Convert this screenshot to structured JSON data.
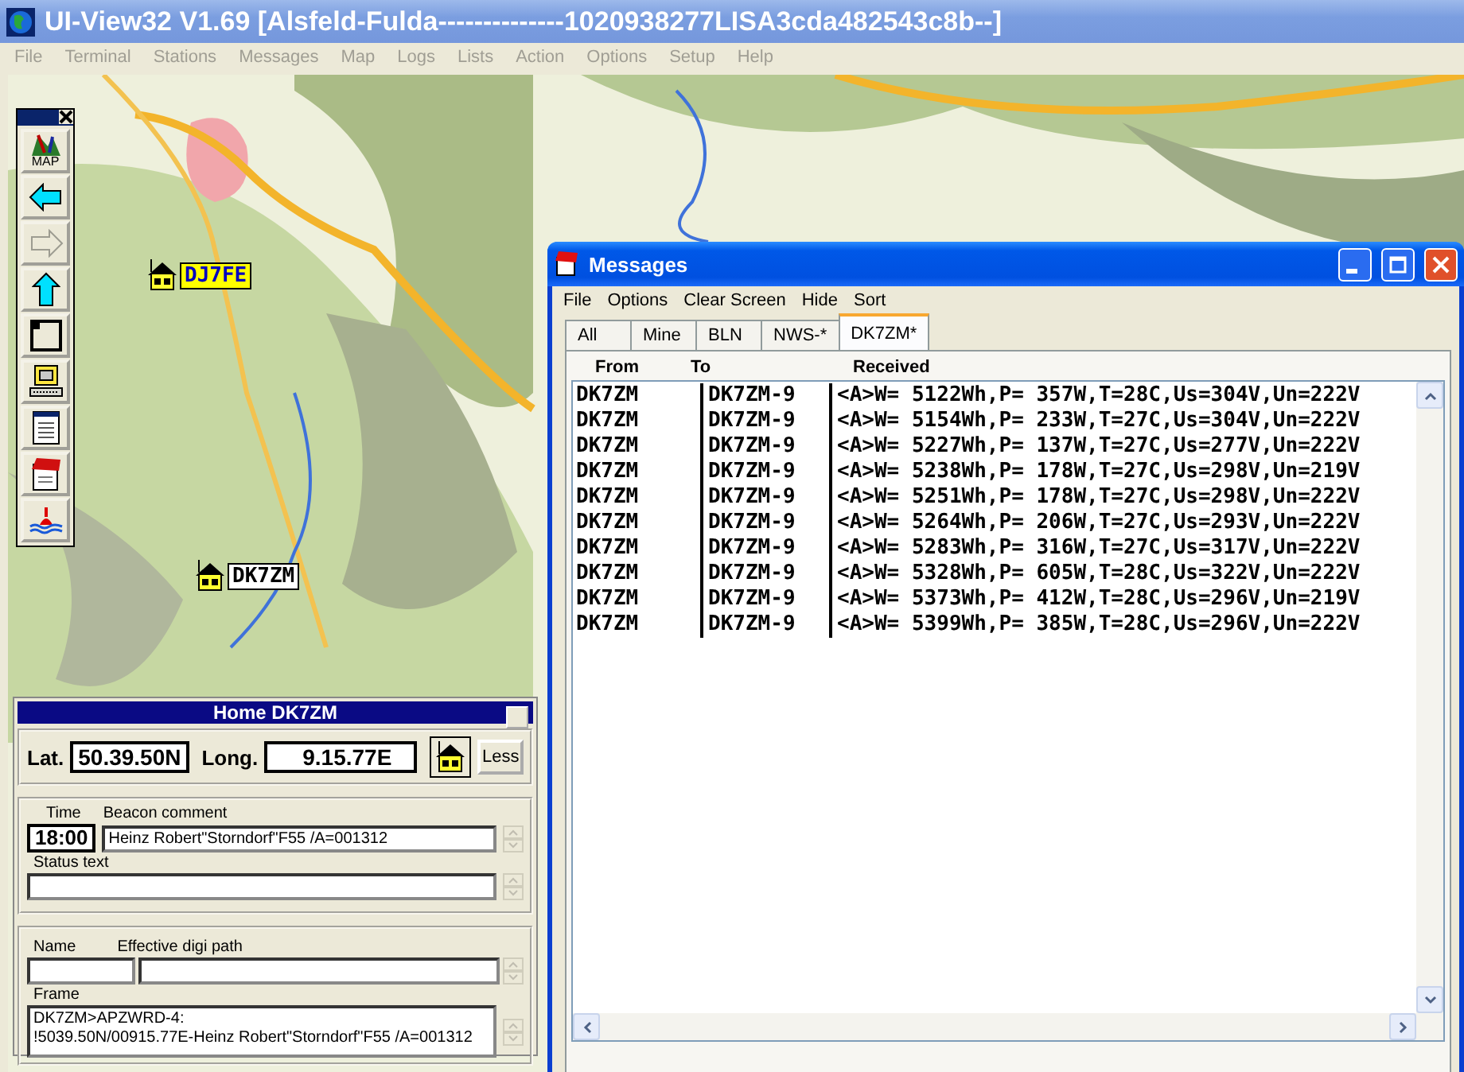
{
  "window": {
    "title": "UI-View32 V1.69 [Alsfeld-Fulda--------------1020938277LISA3cda482543c8b--]"
  },
  "menu": [
    "File",
    "Terminal",
    "Stations",
    "Messages",
    "Map",
    "Logs",
    "Lists",
    "Action",
    "Options",
    "Setup",
    "Help"
  ],
  "toolbar": {
    "buttons": [
      {
        "kind": "map",
        "label": "MAP",
        "disabled": false
      },
      {
        "kind": "back",
        "disabled": false
      },
      {
        "kind": "forward",
        "disabled": true
      },
      {
        "kind": "up",
        "disabled": false
      },
      {
        "kind": "window",
        "disabled": false
      },
      {
        "kind": "computer",
        "disabled": false
      },
      {
        "kind": "document",
        "disabled": false
      },
      {
        "kind": "messages",
        "disabled": false
      },
      {
        "kind": "tide",
        "disabled": false
      }
    ]
  },
  "map": {
    "stations": [
      {
        "callsign": "DJ7FE",
        "color": "#ffff00"
      },
      {
        "callsign": "DK7ZM",
        "color": "#ffffff"
      }
    ]
  },
  "home_panel": {
    "title": "Home DK7ZM",
    "lat_label": "Lat.",
    "lat": "50.39.50N",
    "long_label": "Long.",
    "long": "9.15.77E",
    "less_button": "Less",
    "time_label": "Time",
    "time": "18:00",
    "beacon_label": "Beacon comment",
    "beacon": "Heinz Robert\"Storndorf\"F55 /A=001312",
    "status_label": "Status text",
    "name_label": "Name",
    "digi_label": "Effective digi path",
    "frame_label": "Frame",
    "frame_lines": [
      "DK7ZM>APZWRD-4:",
      "!5039.50N/00915.77E-Heinz Robert\"Storndorf\"F55 /A=001312"
    ]
  },
  "messages": {
    "title": "Messages",
    "menu": [
      "File",
      "Options",
      "Clear Screen",
      "Hide",
      "Sort"
    ],
    "tabs": [
      {
        "label": "All",
        "selected": false
      },
      {
        "label": "Mine",
        "selected": false
      },
      {
        "label": "BLN",
        "selected": false
      },
      {
        "label": "NWS-*",
        "selected": false
      },
      {
        "label": "DK7ZM*",
        "selected": true
      }
    ],
    "columns": [
      "From",
      "To",
      "Received"
    ],
    "rows": [
      {
        "from": "DK7ZM",
        "to": "DK7ZM-9",
        "received": "<A>W= 5122Wh,P= 357W,T=28C,Us=304V,Un=222V"
      },
      {
        "from": "DK7ZM",
        "to": "DK7ZM-9",
        "received": "<A>W= 5154Wh,P= 233W,T=27C,Us=304V,Un=222V"
      },
      {
        "from": "DK7ZM",
        "to": "DK7ZM-9",
        "received": "<A>W= 5227Wh,P= 137W,T=27C,Us=277V,Un=222V"
      },
      {
        "from": "DK7ZM",
        "to": "DK7ZM-9",
        "received": "<A>W= 5238Wh,P= 178W,T=27C,Us=298V,Un=219V"
      },
      {
        "from": "DK7ZM",
        "to": "DK7ZM-9",
        "received": "<A>W= 5251Wh,P= 178W,T=27C,Us=298V,Un=222V"
      },
      {
        "from": "DK7ZM",
        "to": "DK7ZM-9",
        "received": "<A>W= 5264Wh,P= 206W,T=27C,Us=293V,Un=222V"
      },
      {
        "from": "DK7ZM",
        "to": "DK7ZM-9",
        "received": "<A>W= 5283Wh,P= 316W,T=27C,Us=317V,Un=222V"
      },
      {
        "from": "DK7ZM",
        "to": "DK7ZM-9",
        "received": "<A>W= 5328Wh,P= 605W,T=28C,Us=322V,Un=222V"
      },
      {
        "from": "DK7ZM",
        "to": "DK7ZM-9",
        "received": "<A>W= 5373Wh,P= 412W,T=28C,Us=296V,Un=219V"
      },
      {
        "from": "DK7ZM",
        "to": "DK7ZM-9",
        "received": "<A>W= 5399Wh,P= 385W,T=28C,Us=296V,Un=222V"
      }
    ]
  }
}
